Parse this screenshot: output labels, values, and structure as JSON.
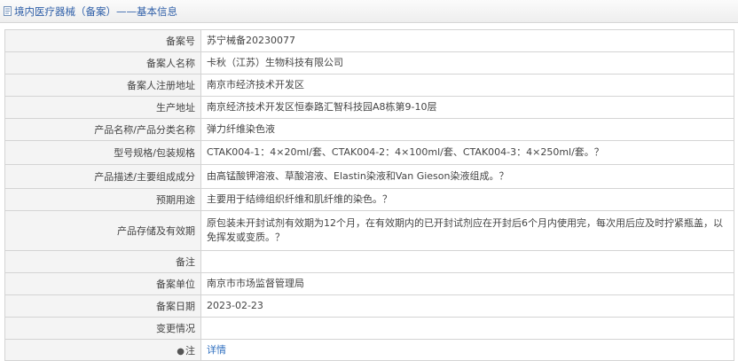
{
  "header": {
    "title": "境内医疗器械（备案）——基本信息"
  },
  "colors": {
    "title_text": "#2f5fa8",
    "label_bg": "#f4f4f4",
    "border": "#d4d4d4",
    "link": "#2f6fc0"
  },
  "rows": [
    {
      "label": "备案号",
      "value": "苏宁械备20230077"
    },
    {
      "label": "备案人名称",
      "value": "卡秋（江苏）生物科技有限公司"
    },
    {
      "label": "备案人注册地址",
      "value": "南京市经济技术开发区"
    },
    {
      "label": "生产地址",
      "value": "南京经济技术开发区恒泰路汇智科技园A8栋第9-10层"
    },
    {
      "label": "产品名称/产品分类名称",
      "value": "弹力纤维染色液"
    },
    {
      "label": "型号规格/包装规格",
      "value": "CTAK004-1：4×20ml/套、CTAK004-2：4×100ml/套、CTAK004-3：4×250ml/套。？"
    },
    {
      "label": "产品描述/主要组成成分",
      "value": "由高锰酸钾溶液、草酸溶液、Elastin染液和Van Gieson染液组成。？"
    },
    {
      "label": "预期用途",
      "value": "主要用于结缔组织纤维和肌纤维的染色。？"
    },
    {
      "label": "产品存储及有效期",
      "value": "原包装未开封试剂有效期为12个月，在有效期内的已开封试剂应在开封后6个月内使用完，每次用后应及时拧紧瓶盖，以免挥发或变质。？"
    },
    {
      "label": "备注",
      "value": ""
    },
    {
      "label": "备案单位",
      "value": "南京市市场监督管理局"
    },
    {
      "label": "备案日期",
      "value": "2023-02-23"
    },
    {
      "label": "变更情况",
      "value": ""
    }
  ],
  "note": {
    "label": "注",
    "link_text": "详情"
  }
}
